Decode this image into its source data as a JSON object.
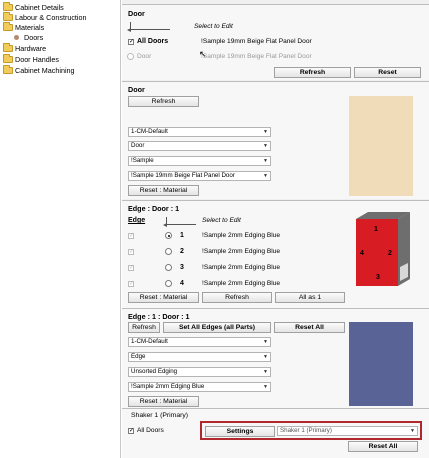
{
  "tree": {
    "items": [
      {
        "label": "Cabinet Details",
        "level": 0
      },
      {
        "label": "Labour & Construction",
        "level": 0
      },
      {
        "label": "Materials",
        "level": 0,
        "expanded": true
      },
      {
        "label": "Doors",
        "level": 1
      },
      {
        "label": "Hardware",
        "level": 0
      },
      {
        "label": "Door Handles",
        "level": 0
      },
      {
        "label": "Cabinet Machining",
        "level": 0
      }
    ],
    "collapse_glyph": "⊟"
  },
  "door_select": {
    "title": "Door",
    "select_hint": "Select to Edit",
    "all_doors_label": "All Doors",
    "all_doors_value": "!Sample 19mm Beige Flat Panel Door",
    "door_radio_label": "Door",
    "door_value": "!Sample 19mm Beige Flat Panel Door",
    "refresh_label": "Refresh",
    "reset_label": "Reset"
  },
  "door_panel": {
    "title": "Door",
    "refresh_label": "Refresh",
    "combos": [
      "1-CM-Default",
      "Door",
      "!Sample",
      "!Sample 19mm Beige Flat Panel Door"
    ],
    "reset_material_label": "Reset : Material",
    "swatch_color": "#f1dcb9"
  },
  "edge_panel": {
    "title": "Edge : Door : 1",
    "edge_label": "Edge",
    "select_hint": "Select to Edit",
    "rows": [
      {
        "num": "1",
        "value": "!Sample 2mm Edging Blue",
        "selected": true
      },
      {
        "num": "2",
        "value": "!Sample 2mm Edging Blue",
        "selected": false
      },
      {
        "num": "3",
        "value": "!Sample 2mm Edging Blue",
        "selected": false
      },
      {
        "num": "4",
        "value": "!Sample 2mm Edging Blue",
        "selected": false
      }
    ],
    "reset_material_label": "Reset : Material",
    "refresh_label": "Refresh",
    "all_as_1_label": "All as 1",
    "diagram_numbers": [
      "1",
      "2",
      "3",
      "4"
    ]
  },
  "edge_material_panel": {
    "title": "Edge : 1 : Door : 1",
    "refresh_label": "Refresh",
    "set_all_label": "Set All Edges (all Parts)",
    "reset_all_label": "Reset All",
    "combos": [
      "1-CM-Default",
      "Edge",
      "Unsorted Edging",
      "!Sample 2mm Edging Blue"
    ],
    "reset_material_label": "Reset : Material",
    "swatch_color": "#5a6396"
  },
  "style_panel": {
    "title": "Shaker 1 (Primary)",
    "all_doors_label": "All Doors",
    "settings_label": "Settings",
    "style_combo": "Shaker 1 (Primary)",
    "reset_all_label": "Reset All",
    "highlight_color": "#b0282d"
  },
  "colors": {
    "diagram_red": "#d81c24",
    "diagram_gray": "#6e6e6e",
    "diagram_light": "#d8d8d8"
  }
}
